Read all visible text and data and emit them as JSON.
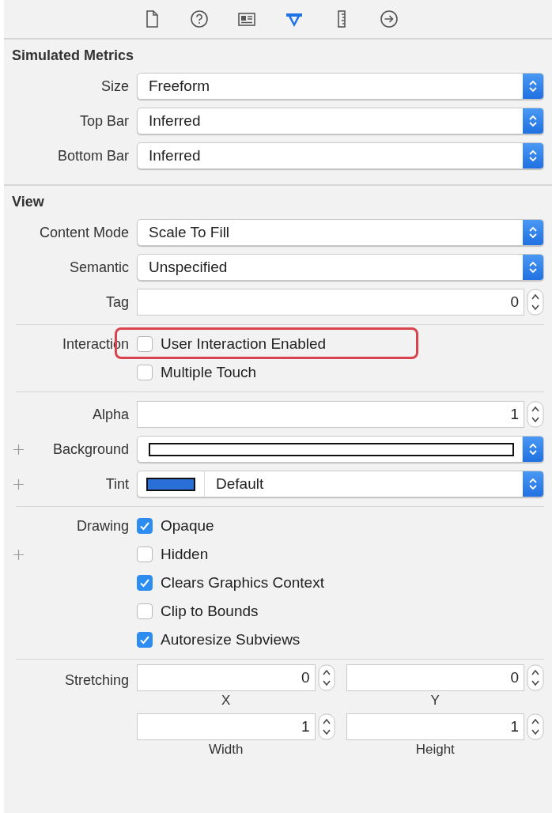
{
  "toolbar": {
    "tabs": [
      {
        "kind": "file",
        "selected": false
      },
      {
        "kind": "help",
        "selected": false
      },
      {
        "kind": "identity",
        "selected": false
      },
      {
        "kind": "attributes",
        "selected": true
      },
      {
        "kind": "ruler",
        "selected": false
      },
      {
        "kind": "connections",
        "selected": false
      }
    ]
  },
  "sections": [
    {
      "title": "Simulated Metrics",
      "items": [
        {
          "kind": "popup",
          "label": "Size",
          "value": "Freeform"
        },
        {
          "kind": "popup",
          "label": "Top Bar",
          "value": "Inferred"
        },
        {
          "kind": "popup",
          "label": "Bottom Bar",
          "value": "Inferred"
        }
      ]
    },
    {
      "title": "View",
      "items": [
        {
          "kind": "popup",
          "label": "Content Mode",
          "value": "Scale To Fill"
        },
        {
          "kind": "popup",
          "label": "Semantic",
          "value": "Unspecified"
        },
        {
          "kind": "stepper",
          "label": "Tag",
          "value": "0"
        },
        {
          "kind": "divider"
        },
        {
          "kind": "checks",
          "label": "Interaction",
          "checks": [
            {
              "label": "User Interaction Enabled",
              "checked": false,
              "highlighted": true
            },
            {
              "label": "Multiple Touch",
              "checked": false
            }
          ]
        },
        {
          "kind": "divider"
        },
        {
          "kind": "stepper",
          "label": "Alpha",
          "value": "1"
        },
        {
          "kind": "color",
          "label": "Background",
          "plus": true,
          "color": "#ffffff"
        },
        {
          "kind": "color",
          "label": "Tint",
          "plus": true,
          "color": "#2a6fd8",
          "value": "Default"
        },
        {
          "kind": "divider"
        },
        {
          "kind": "checks",
          "label": "Drawing",
          "checks": [
            {
              "label": "Opaque",
              "checked": true
            },
            {
              "label": "Hidden",
              "checked": false,
              "plus": true
            },
            {
              "label": "Clears Graphics Context",
              "checked": true
            },
            {
              "label": "Clip to Bounds",
              "checked": false
            },
            {
              "label": "Autoresize Subviews",
              "checked": true
            }
          ]
        },
        {
          "kind": "divider"
        },
        {
          "kind": "stretching",
          "label": "Stretching",
          "fields": [
            {
              "value": "0",
              "caption": "X"
            },
            {
              "value": "0",
              "caption": "Y"
            },
            {
              "value": "1",
              "caption": "Width"
            },
            {
              "value": "1",
              "caption": "Height"
            }
          ]
        }
      ]
    }
  ]
}
